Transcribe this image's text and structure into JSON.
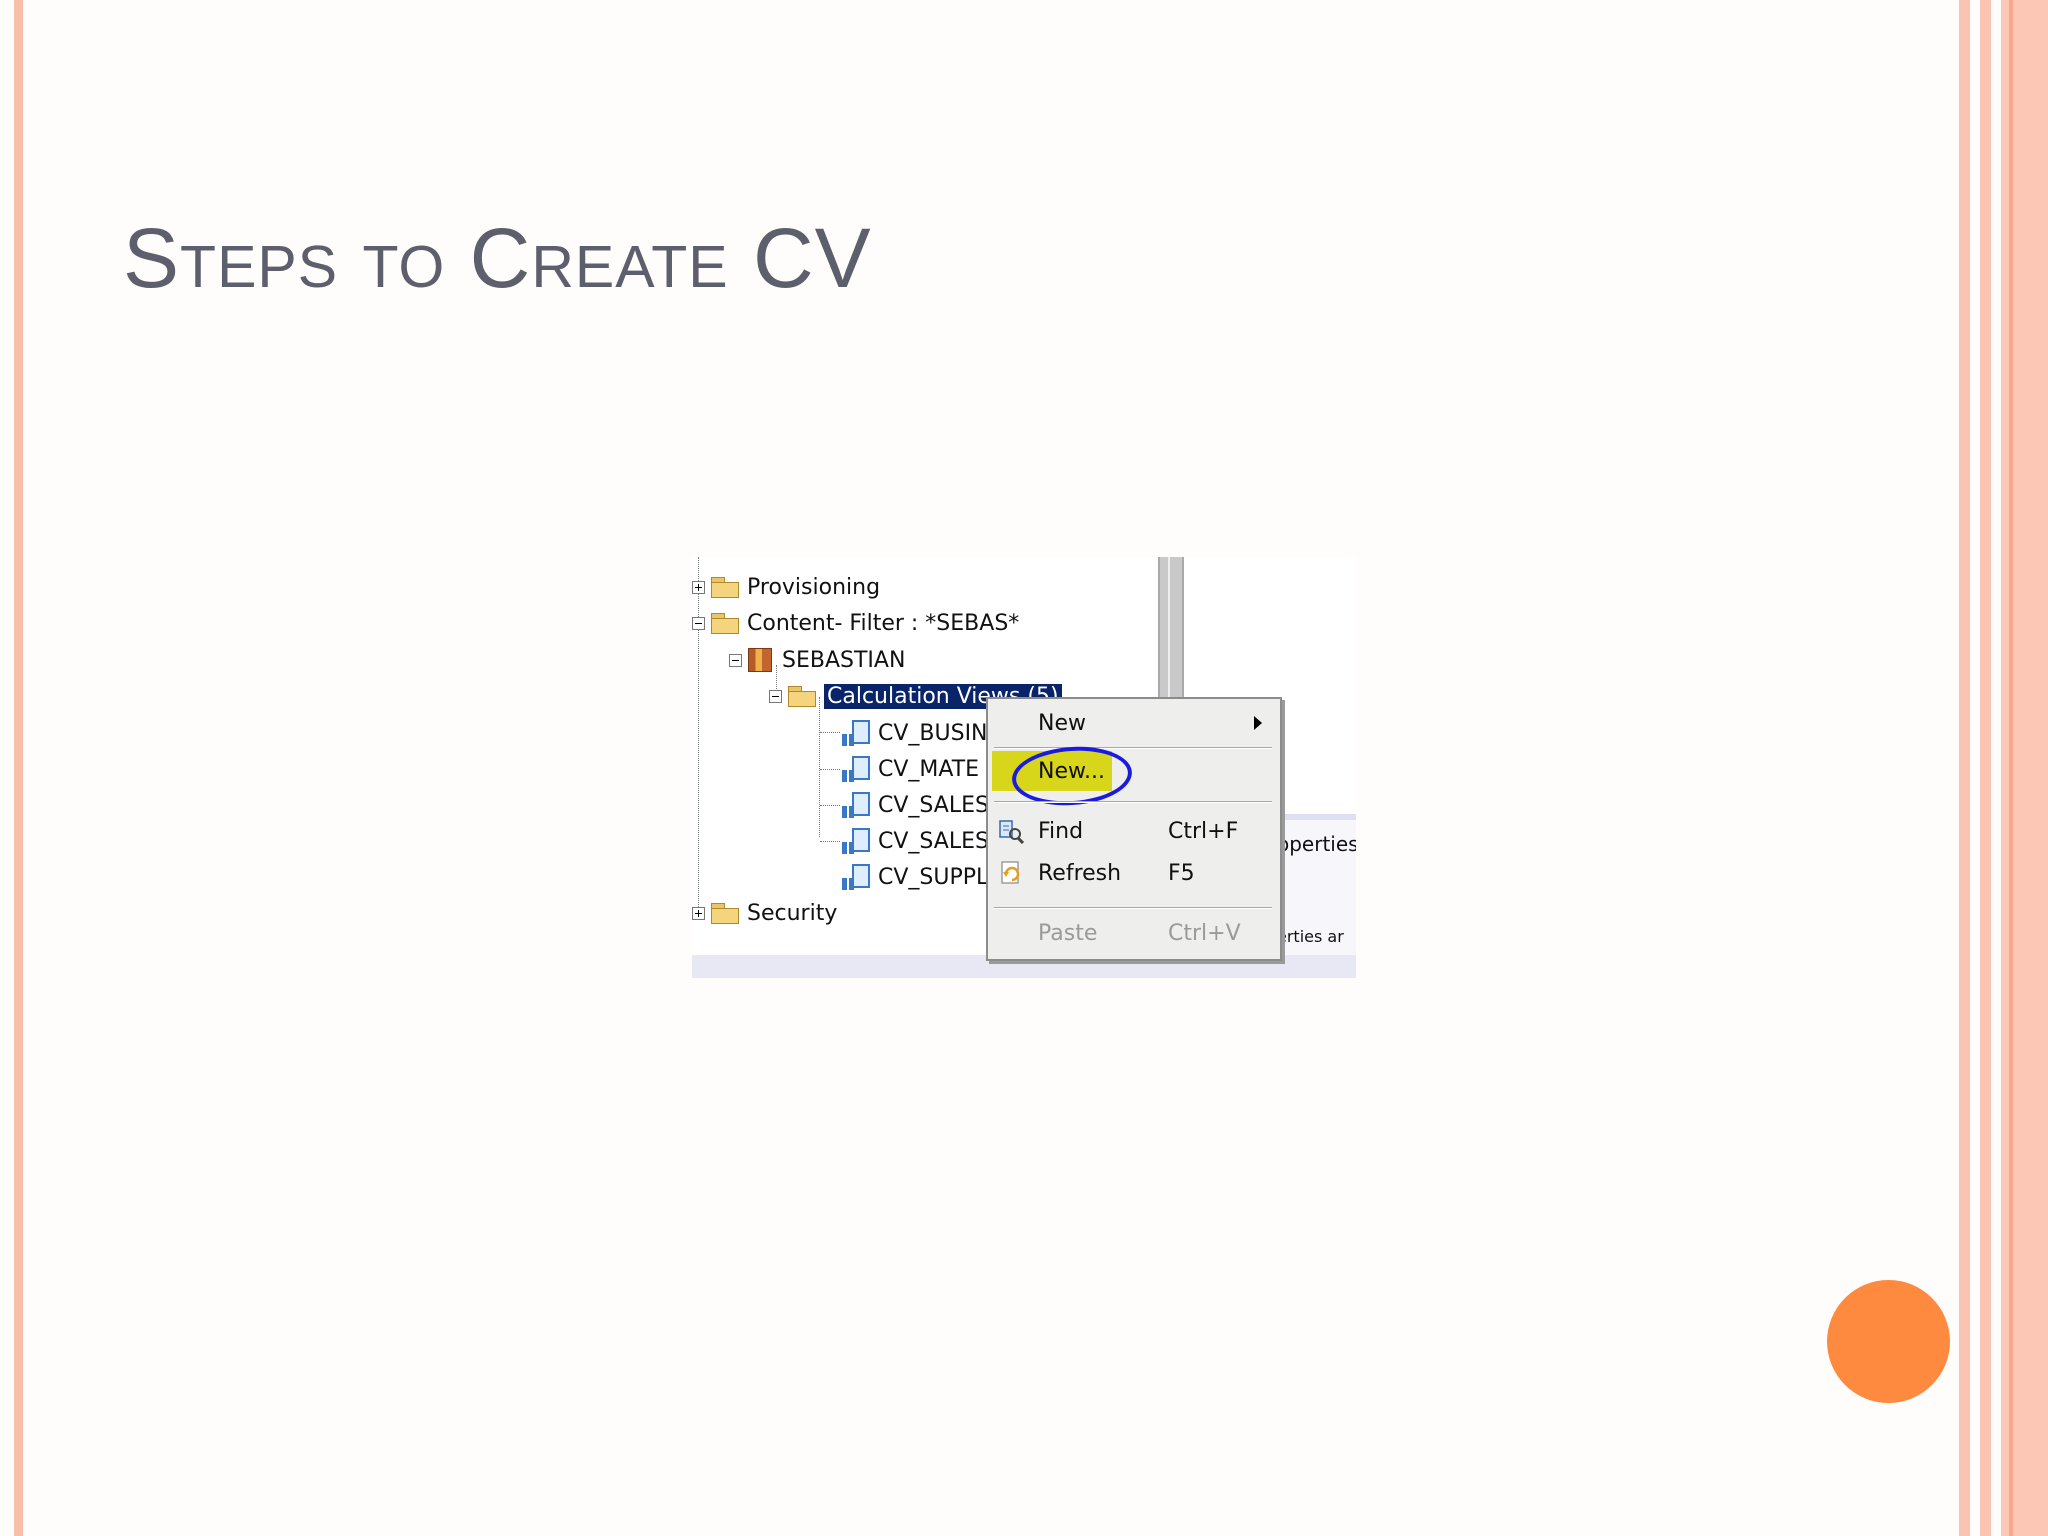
{
  "slide": {
    "title": "Steps to Create CV"
  },
  "tree": {
    "items": [
      {
        "label": "Provisioning",
        "expander": "plus"
      },
      {
        "label": "Content- Filter : *SEBAS*",
        "expander": "minus"
      },
      {
        "label": "SEBASTIAN",
        "expander": "minus"
      },
      {
        "label": "Calculation Views (5)",
        "expander": "minus"
      },
      {
        "label": "CV_BUSIN"
      },
      {
        "label": "CV_MATE"
      },
      {
        "label": "CV_SALES"
      },
      {
        "label": "CV_SALES"
      },
      {
        "label": "CV_SUPPL"
      },
      {
        "label": "Security",
        "expander": "plus"
      }
    ]
  },
  "panel": {
    "properties_partial": "operties",
    "properties_partial2": "erties ar"
  },
  "context_menu": {
    "new": "New",
    "new_ellipsis": "New...",
    "find": "Find",
    "find_shortcut": "Ctrl+F",
    "refresh": "Refresh",
    "refresh_shortcut": "F5",
    "paste": "Paste",
    "paste_shortcut": "Ctrl+V"
  },
  "colors": {
    "title": "#5d5f6c",
    "accent_orb": "#fe8a40",
    "border": "#f9c5b2",
    "selection": "#0a246a",
    "highlight": "#d7d61a",
    "circle": "#1b1be0"
  }
}
